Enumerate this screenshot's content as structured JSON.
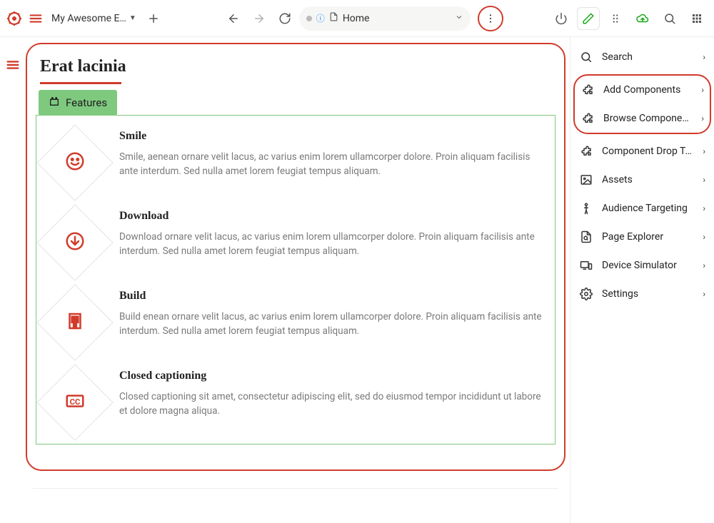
{
  "header": {
    "project_name": "My Awesome E…",
    "address": "Home"
  },
  "page": {
    "title": "Erat lacinia",
    "chip_label": "Features"
  },
  "features": [
    {
      "title": "Smile",
      "desc": "Smile, aenean ornare velit lacus, ac varius enim lorem ullamcorper dolore. Proin aliquam facilisis ante interdum. Sed nulla amet lorem feugiat tempus aliquam."
    },
    {
      "title": "Download",
      "desc": "Download ornare velit lacus, ac varius enim lorem ullamcorper dolore. Proin aliquam facilisis ante interdum. Sed nulla amet lorem feugiat tempus aliquam."
    },
    {
      "title": "Build",
      "desc": "Build enean ornare velit lacus, ac varius enim lorem ullamcorper dolore. Proin aliquam facilisis ante interdum. Sed nulla amet lorem feugiat tempus aliquam."
    },
    {
      "title": "Closed captioning",
      "desc": "Closed captioning sit amet, consectetur adipiscing elit, sed do eiusmod tempor incididunt ut labore et dolore magna aliqua."
    }
  ],
  "right_panel": {
    "search": "Search",
    "add_components": "Add Components",
    "browse_components": "Browse Components",
    "drop_target": "Component Drop Ta…",
    "assets": "Assets",
    "audience": "Audience Targeting",
    "page_explorer": "Page Explorer",
    "device_sim": "Device Simulator",
    "settings": "Settings"
  }
}
